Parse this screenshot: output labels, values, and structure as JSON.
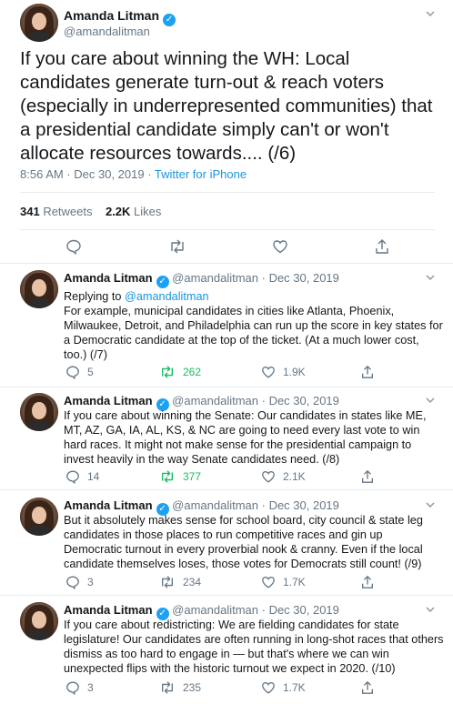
{
  "main_tweet": {
    "author_name": "Amanda Litman",
    "handle": "@amandalitman",
    "text": "If you care about winning the WH: Local candidates generate turn-out & reach voters (especially in underrepresented communities) that a presidential candidate simply can't or won't allocate resources towards.... (/6)",
    "timestamp": "8:56 AM · Dec 30, 2019 · ",
    "source": "Twitter for iPhone",
    "retweets_count": "341",
    "retweets_label": " Retweets",
    "likes_count": "2.2K",
    "likes_label": " Likes"
  },
  "replies": [
    {
      "author_name": "Amanda Litman",
      "handle": "@amandalitman",
      "date": "Dec 30, 2019",
      "replying_to_label": "Replying to ",
      "replying_to_handle": "@amandalitman",
      "text": "For example, municipal candidates in cities like Atlanta, Phoenix, Milwaukee, Detroit, and Philadelphia can run up the score in key states for a Democratic candidate at the top of the ticket. (At a much lower cost, too.) (/7)",
      "replies": "5",
      "retweets": "262",
      "likes": "1.9K"
    },
    {
      "author_name": "Amanda Litman",
      "handle": "@amandalitman",
      "date": "Dec 30, 2019",
      "text": "If you care about winning the Senate: Our candidates in states like ME, MT, AZ, GA, IA, AL, KS, & NC are going to need every last vote to win hard races. It might not make sense for the presidential campaign to invest heavily in the way Senate candidates need. (/8)",
      "replies": "14",
      "retweets": "377",
      "likes": "2.1K"
    },
    {
      "author_name": "Amanda Litman",
      "handle": "@amandalitman",
      "date": "Dec 30, 2019",
      "text": "But it absolutely makes sense for school board, city council & state leg candidates in those places to run competitive races and gin up Democratic turnout in every proverbial nook & cranny. Even if the local candidate themselves loses, those votes for Democrats still count! (/9)",
      "replies": "3",
      "retweets": "234",
      "likes": "1.7K"
    },
    {
      "author_name": "Amanda Litman",
      "handle": "@amandalitman",
      "date": "Dec 30, 2019",
      "text": "If you care about redistricting: We are fielding candidates for state legislature! Our candidates are often running in long-shot races that others dismiss as too hard to engage in — but that's where we can win unexpected flips with the historic turnout we expect in 2020. (/10)",
      "replies": "3",
      "retweets": "235",
      "likes": "1.7K"
    }
  ],
  "separator": " · ",
  "colors": {
    "accent": "#1da1f2",
    "link": "#1b95e0",
    "retweeted": "#17bf63",
    "secondary_text": "#657786",
    "divider": "#e6ecf0"
  },
  "icons": [
    "verified-badge-icon",
    "chevron-down-icon",
    "reply-icon",
    "retweet-icon",
    "like-icon",
    "share-icon"
  ]
}
